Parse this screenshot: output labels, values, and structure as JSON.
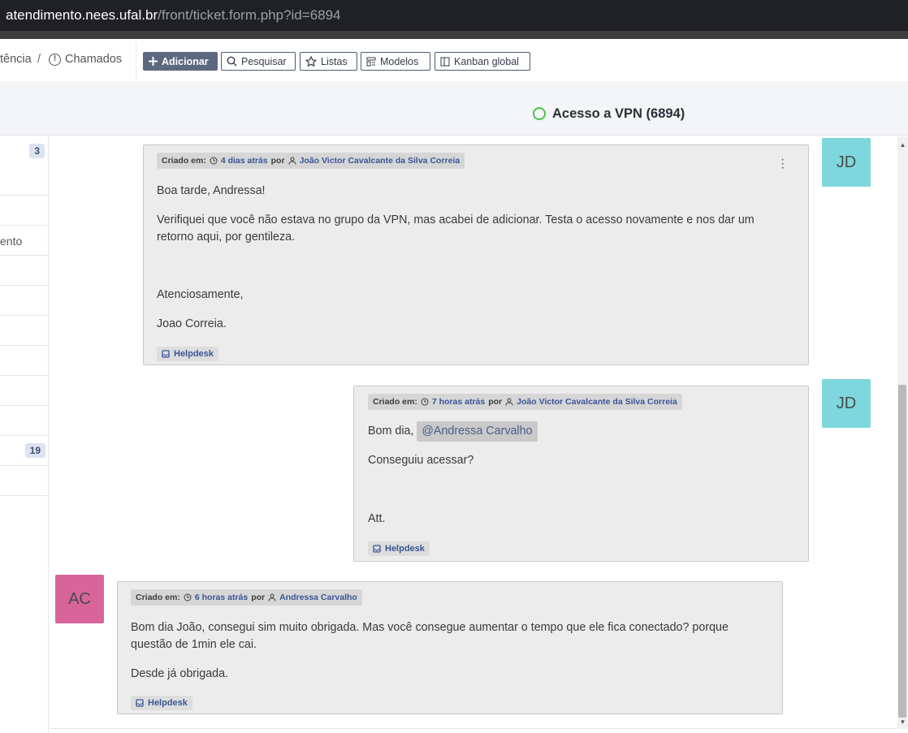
{
  "url": {
    "host": "atendimento.nees.ufal.br",
    "path": "/front/ticket.form.php?id=6894"
  },
  "nav": {
    "breadcrumb_assistance": "tência",
    "breadcrumb_sep": "/",
    "breadcrumb_tickets": "Chamados",
    "buttons": {
      "add": "Adicionar",
      "search": "Pesquisar",
      "lists": "Listas",
      "templates": "Modelos",
      "kanban": "Kanban global"
    }
  },
  "ticket": {
    "title": "Acesso a VPN (6894)",
    "status_color": "#4ac44a"
  },
  "sidebar": {
    "badge_top": "3",
    "partial_label": "ento",
    "badge_bottom": "19"
  },
  "followups": [
    {
      "created_label": "Criado em:",
      "time": "4 dias atrás",
      "by": "por",
      "author": "João Victor Cavalcante da Silva Correia",
      "avatar": "JD",
      "avatar_color": "#7dd7dc",
      "lines": [
        "Boa tarde, Andressa!",
        "Verifiquei que você não estava no grupo da VPN, mas acabei de adicionar. Testa o acesso novamente e nos dar um",
        "retorno aqui, por gentileza.",
        "Atenciosamente,",
        "Joao Correia."
      ],
      "source": "Helpdesk"
    },
    {
      "created_label": "Criado em:",
      "time": "7 horas atrás",
      "by": "por",
      "author": "João Victor Cavalcante da Silva Correia",
      "avatar": "JD",
      "avatar_color": "#7dd7dc",
      "greeting": "Bom dia,",
      "mention": "@Andressa Carvalho",
      "lines": [
        "Conseguiu acessar?",
        "Att."
      ],
      "source": "Helpdesk"
    },
    {
      "created_label": "Criado em:",
      "time": "6 horas atrás",
      "by": "por",
      "author": "Andressa Carvalho",
      "avatar": "AC",
      "avatar_color": "#d9649a",
      "lines": [
        "Bom dia João, consegui sim muito obrigada. Mas você consegue aumentar o tempo que ele fica conectado? porque",
        "questão de 1min ele cai.",
        "Desde já obrigada."
      ],
      "source": "Helpdesk"
    }
  ]
}
